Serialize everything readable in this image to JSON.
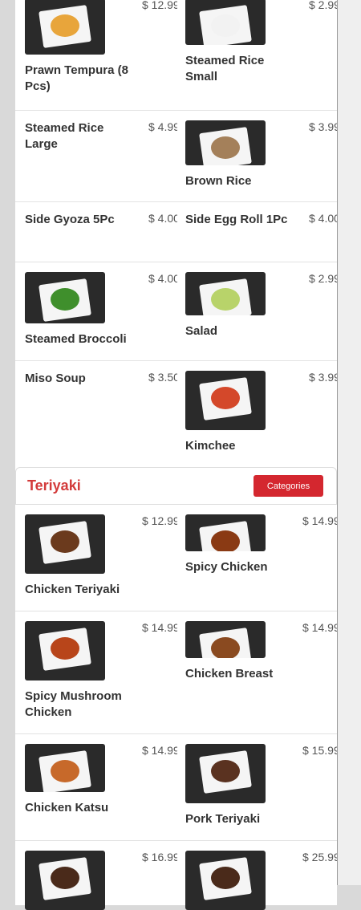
{
  "top_rows": [
    {
      "left": {
        "name": "Prawn Tempura (8 Pcs)",
        "price": "$ 12.99",
        "food_color": "#e8a53b"
      },
      "right": {
        "name": "Steamed Rice Small",
        "price": "$ 2.99",
        "food_color": "#f2f2f2"
      }
    },
    {
      "left": {
        "name": "Steamed Rice Large",
        "price": "$ 4.99"
      },
      "right": {
        "name": "Brown Rice",
        "price": "$ 3.99",
        "food_color": "#a4805a"
      }
    },
    {
      "left": {
        "name": "Side Gyoza 5Pc",
        "price": "$ 4.00"
      },
      "right": {
        "name": "Side Egg Roll 1Pc",
        "price": "$ 4.00"
      }
    },
    {
      "left": {
        "name": "Steamed Broccoli",
        "price": "$ 4.00",
        "food_color": "#3f8f2c"
      },
      "right": {
        "name": "Salad",
        "price": "$ 2.99",
        "food_color": "#b8d36a"
      }
    },
    {
      "left": {
        "name": "Miso Soup",
        "price": "$ 3.50"
      },
      "right": {
        "name": "Kimchee",
        "price": "$ 3.99",
        "food_color": "#d4482a"
      }
    }
  ],
  "teriyaki": {
    "title": "Teriyaki",
    "button": "Categories",
    "rows": [
      {
        "left": {
          "name": "Chicken Teriyaki",
          "price": "$ 12.99",
          "food_color": "#6b3a1d"
        },
        "right": {
          "name": "Spicy Chicken",
          "price": "$ 14.99",
          "food_color": "#8a3a14"
        }
      },
      {
        "left": {
          "name": "Spicy Mushroom Chicken",
          "price": "$ 14.99",
          "food_color": "#b8451a"
        },
        "right": {
          "name": "Chicken Breast",
          "price": "$ 14.99",
          "food_color": "#8a4a20"
        }
      },
      {
        "left": {
          "name": "Chicken Katsu",
          "price": "$ 14.99",
          "food_color": "#c7692a"
        },
        "right": {
          "name": "Pork Teriyaki",
          "price": "$ 15.99",
          "food_color": "#5a3220"
        }
      },
      {
        "left": {
          "name": "",
          "price": "$ 16.99",
          "food_color": "#4a2a1a"
        },
        "right": {
          "name": "",
          "price": "$ 25.99",
          "food_color": "#4a2a1a"
        }
      }
    ]
  }
}
